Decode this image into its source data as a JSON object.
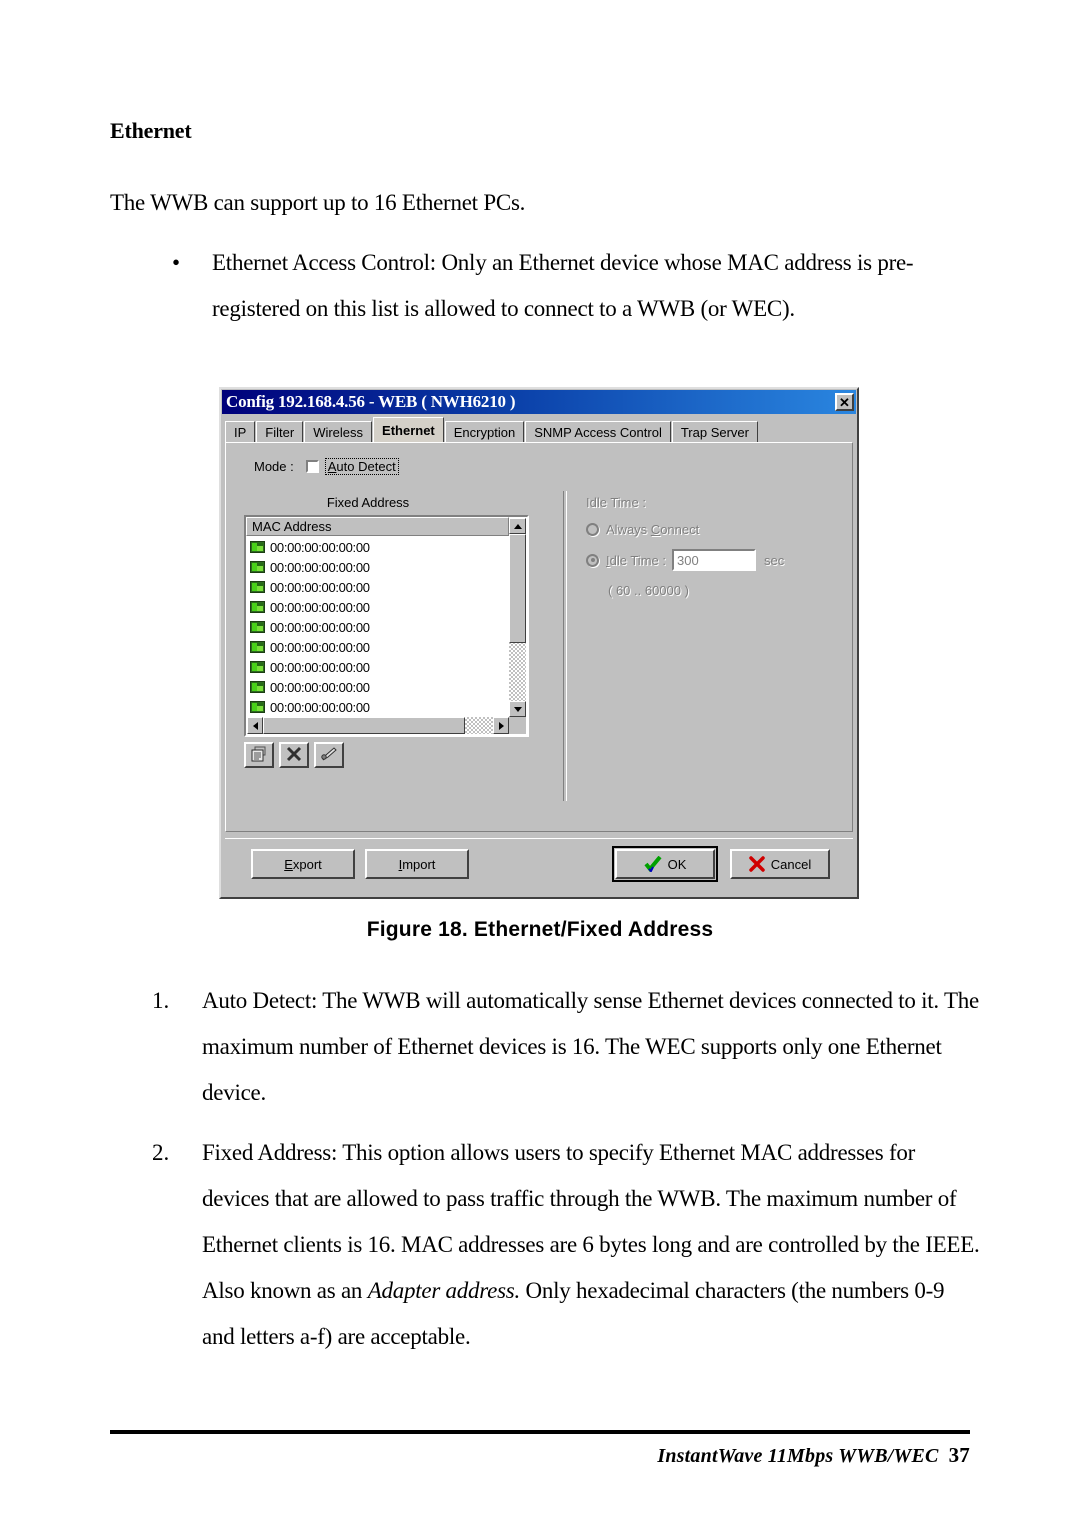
{
  "document": {
    "heading": "Ethernet",
    "intro": "The WWB can support up to 16 Ethernet PCs.",
    "bullet_marker": "•",
    "bullet": "Ethernet Access Control:    Only an Ethernet device whose MAC address is pre-registered on this list is allowed to connect to a WWB (or WEC).",
    "figure_caption": "Figure 18.   Ethernet/Fixed Address",
    "items": [
      {
        "number": "1.",
        "text": "Auto Detect:    The WWB will automatically sense Ethernet devices connected to it.    The maximum number of Ethernet devices is 16.    The WEC supports only one Ethernet device."
      },
      {
        "number": "2.",
        "text_part1": "Fixed Address:    This option allows users to specify Ethernet MAC addresses for devices that are allowed to pass traffic through the WWB.  The maximum number of Ethernet clients is 16.    MAC addresses are 6 bytes long and are controlled by the IEEE.    Also known as an ",
        "italic1": "Adapter address.",
        "text_part2": "    Only hexadecimal characters (the numbers 0-9 and letters a-f) are acceptable."
      }
    ],
    "footer": {
      "product": "InstantWave 11Mbps WWB/WEC",
      "page_number": "37"
    }
  },
  "dialog": {
    "title": "Config 192.168.4.56 - WEB ( NWH6210 )",
    "close_label": "✕",
    "tabs": [
      {
        "label": "IP",
        "active": false
      },
      {
        "label": "Filter",
        "active": false
      },
      {
        "label": "Wireless",
        "active": false
      },
      {
        "label": "Ethernet",
        "active": true
      },
      {
        "label": "Encryption",
        "active": false
      },
      {
        "label": "SNMP Access Control",
        "active": false
      },
      {
        "label": "Trap Server",
        "active": false
      }
    ],
    "mode": {
      "label": "Mode :",
      "auto_detect_label": "Auto Detect",
      "auto_detect_accel": "A",
      "auto_detect_rest": "uto Detect",
      "checked": false
    },
    "fixed_address": {
      "group_title": "Fixed Address",
      "column_header": "MAC Address",
      "rows": [
        "00:00:00:00:00:00",
        "00:00:00:00:00:00",
        "00:00:00:00:00:00",
        "00:00:00:00:00:00",
        "00:00:00:00:00:00",
        "00:00:00:00:00:00",
        "00:00:00:00:00:00",
        "00:00:00:00:00:00",
        "00:00:00:00:00:00"
      ],
      "toolbar": [
        {
          "name": "new-entry",
          "icon": "document-properties-icon"
        },
        {
          "name": "delete-entry",
          "icon": "x-delete-icon"
        },
        {
          "name": "edit-entry",
          "icon": "pen-edit-icon"
        }
      ]
    },
    "idle": {
      "title": "Idle Time :",
      "always_connect_accel": "C",
      "always_connect_pre": "Always ",
      "always_connect_post": "onnect",
      "idle_time_accel": "I",
      "idle_time_post": "dle Time :",
      "value": "300",
      "unit": "sec",
      "range_note": "( 60 .. 60000 )",
      "selected": "idle_time",
      "disabled": true
    },
    "buttons": {
      "export_accel": "E",
      "export_post": "xport",
      "import_accel": "I",
      "import_post": "mport",
      "ok": "OK",
      "cancel": "Cancel"
    },
    "colors": {
      "face": "#c0c0c0",
      "title_gradient_start": "#00007a",
      "title_gradient_end": "#2a86e0",
      "ok_check": "#00a000",
      "cancel_x": "#d00000",
      "nic_green": "#49d119"
    }
  }
}
